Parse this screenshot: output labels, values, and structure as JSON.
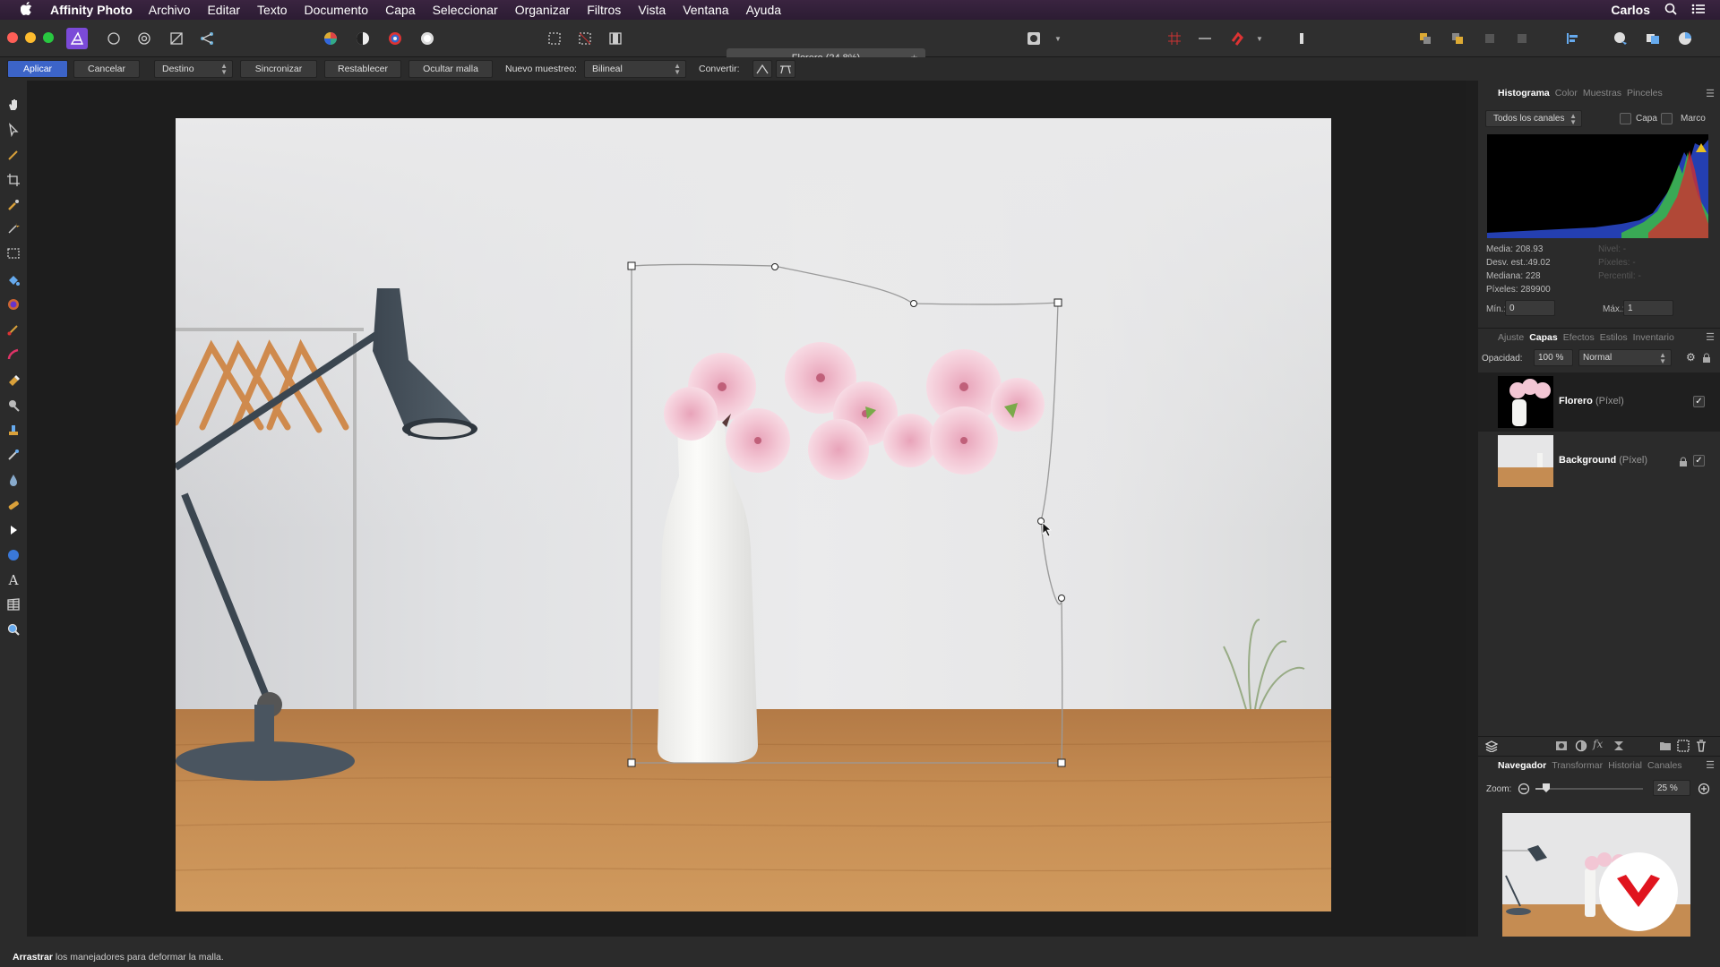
{
  "menubar": {
    "app_name": "Affinity Photo",
    "items": [
      "Archivo",
      "Editar",
      "Texto",
      "Documento",
      "Capa",
      "Seleccionar",
      "Organizar",
      "Filtros",
      "Vista",
      "Ventana",
      "Ayuda"
    ],
    "user": "Carlos"
  },
  "toolbar": {
    "document_tab": "Florero (24.8%)"
  },
  "context": {
    "apply": "Aplicar",
    "cancel": "Cancelar",
    "target_value": "Destino",
    "sync": "Sincronizar",
    "reset": "Restablecer",
    "hide_mesh": "Ocultar malla",
    "resample_label": "Nuevo muestreo:",
    "resample_value": "Bilineal",
    "convert_label": "Convertir:"
  },
  "histogram": {
    "tabs": [
      "Histograma",
      "Color",
      "Muestras",
      "Pinceles"
    ],
    "channels": "Todos los canales",
    "layer_opt": "Capa",
    "frame_opt": "Marco",
    "stats_left": [
      "Media: 208.93",
      "Desv. est.:49.02",
      "Mediana: 228",
      "Píxeles: 289900"
    ],
    "stats_right": [
      "Nivel: -",
      "Píxeles: -",
      "Percentil: -"
    ],
    "min_label": "Mín.:",
    "min_value": "0",
    "max_label": "Máx.:",
    "max_value": "1"
  },
  "layers": {
    "tabs": [
      "Ajuste",
      "Capas",
      "Efectos",
      "Estilos",
      "Inventario"
    ],
    "opacity_label": "Opacidad:",
    "opacity_value": "100 %",
    "blend_mode": "Normal",
    "items": [
      {
        "name": "Florero",
        "kind": "(Píxel)"
      },
      {
        "name": "Background",
        "kind": "(Píxel)"
      }
    ]
  },
  "navigator": {
    "tabs": [
      "Navegador",
      "Transformar",
      "Historial",
      "Canales"
    ],
    "zoom_label": "Zoom:",
    "zoom_value": "25 %",
    "zoom_level": 0.25
  },
  "status": {
    "bold": "Arrastrar",
    "text": " los manejadores para deformar la malla."
  },
  "colors": {
    "accent": "#3c64c8",
    "warp_handle": "#ffffff"
  }
}
